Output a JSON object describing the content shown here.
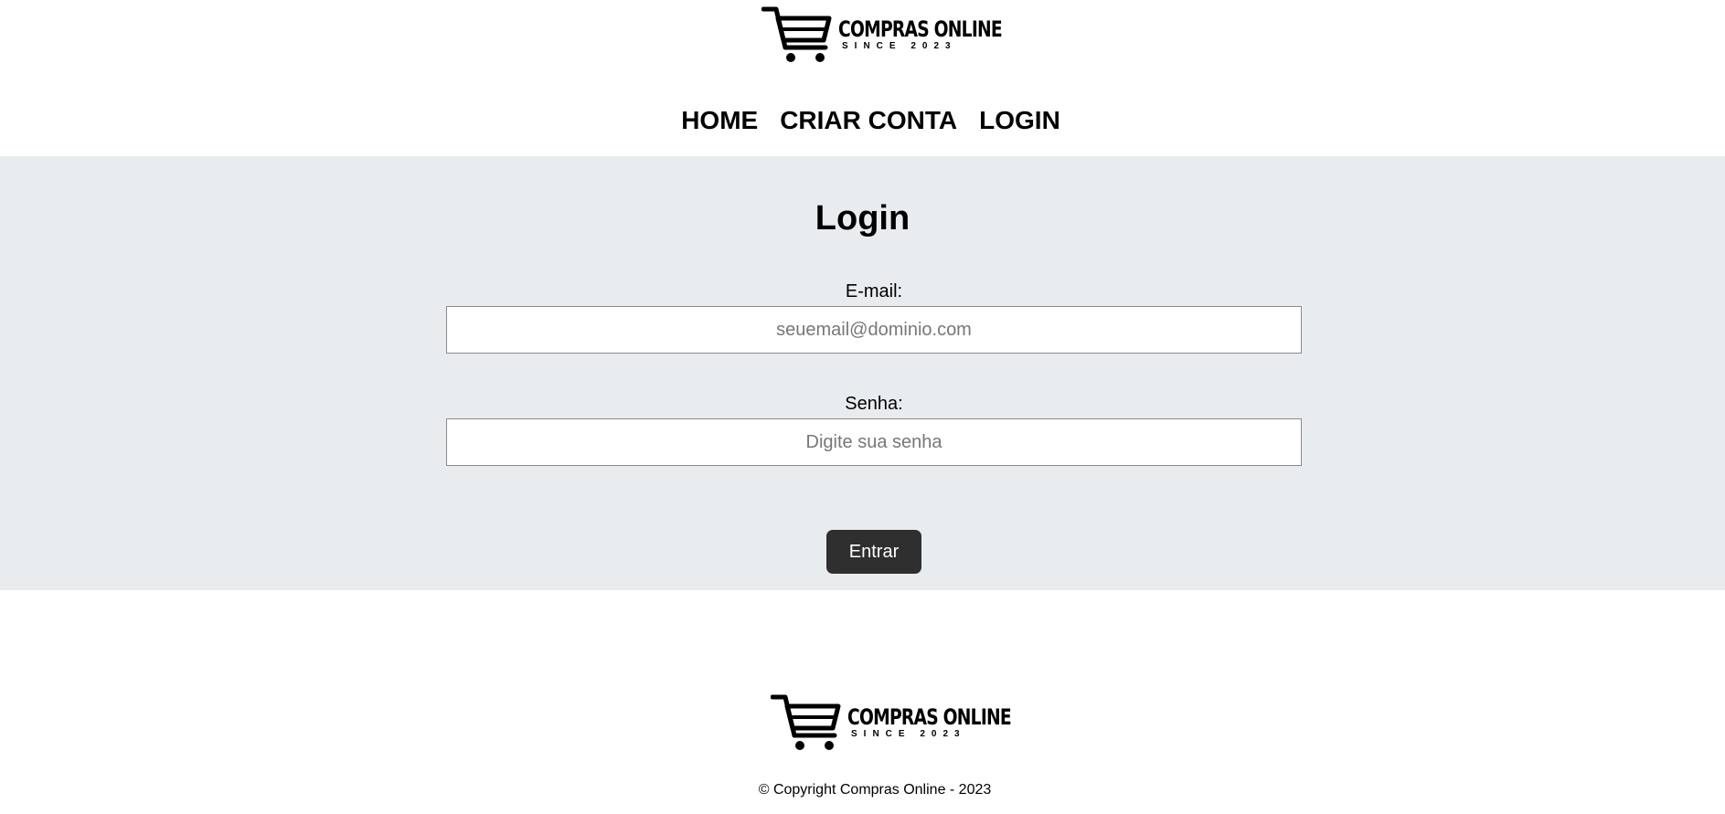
{
  "brand": {
    "name": "COMPRAS ONLINE",
    "since": "SINCE 2023"
  },
  "nav": {
    "items": [
      {
        "label": "HOME"
      },
      {
        "label": "CRIAR CONTA"
      },
      {
        "label": "LOGIN"
      }
    ]
  },
  "login": {
    "title": "Login",
    "email_label": "E-mail:",
    "email_placeholder": "seuemail@dominio.com",
    "email_value": "",
    "password_label": "Senha:",
    "password_placeholder": "Digite sua senha",
    "password_value": "",
    "submit_label": "Entrar"
  },
  "footer": {
    "copyright": "© Copyright Compras Online - 2023"
  },
  "colors": {
    "main_background": "#e8ecee",
    "button_background": "#2f2f2f",
    "button_text": "#ffffff"
  },
  "icons": {
    "logo": "shopping-cart-icon"
  }
}
